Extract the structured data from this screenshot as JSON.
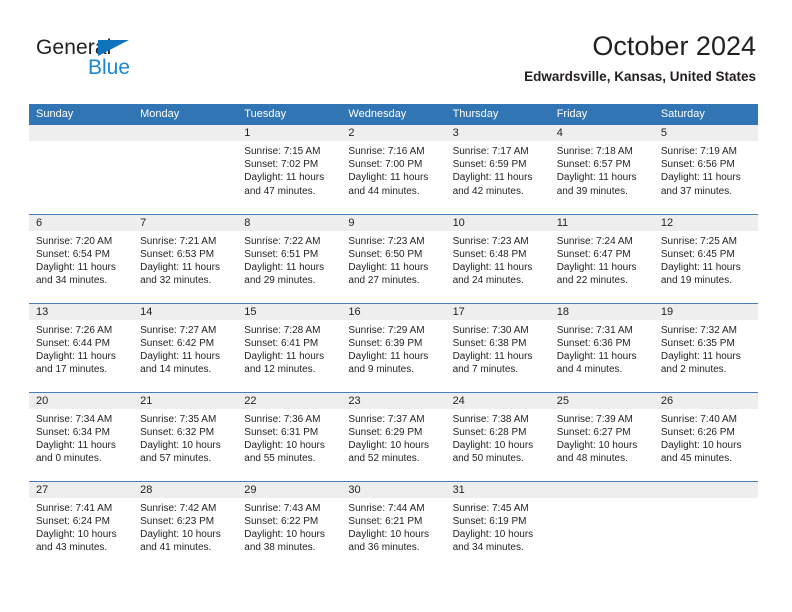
{
  "brand": {
    "name_part1": "General",
    "name_part2": "Blue",
    "accent_color": "#1b87d4",
    "triangle_color": "#0f72bd"
  },
  "header": {
    "title": "October 2024",
    "location": "Edwardsville, Kansas, United States"
  },
  "theme": {
    "header_blue": "#3275b5",
    "row_divider": "#4a7ebb",
    "daynum_band": "#eeeeee",
    "text": "#231f20"
  },
  "weekday_headers": [
    "Sunday",
    "Monday",
    "Tuesday",
    "Wednesday",
    "Thursday",
    "Friday",
    "Saturday"
  ],
  "labels": {
    "sunrise_prefix": "Sunrise: ",
    "sunset_prefix": "Sunset: ",
    "daylight_prefix": "Daylight: "
  },
  "weeks": [
    [
      {
        "day": "",
        "sunrise": "",
        "sunset": "",
        "daylight_line1": "",
        "daylight_line2": ""
      },
      {
        "day": "",
        "sunrise": "",
        "sunset": "",
        "daylight_line1": "",
        "daylight_line2": ""
      },
      {
        "day": "1",
        "sunrise": "Sunrise: 7:15 AM",
        "sunset": "Sunset: 7:02 PM",
        "daylight_line1": "Daylight: 11 hours",
        "daylight_line2": "and 47 minutes."
      },
      {
        "day": "2",
        "sunrise": "Sunrise: 7:16 AM",
        "sunset": "Sunset: 7:00 PM",
        "daylight_line1": "Daylight: 11 hours",
        "daylight_line2": "and 44 minutes."
      },
      {
        "day": "3",
        "sunrise": "Sunrise: 7:17 AM",
        "sunset": "Sunset: 6:59 PM",
        "daylight_line1": "Daylight: 11 hours",
        "daylight_line2": "and 42 minutes."
      },
      {
        "day": "4",
        "sunrise": "Sunrise: 7:18 AM",
        "sunset": "Sunset: 6:57 PM",
        "daylight_line1": "Daylight: 11 hours",
        "daylight_line2": "and 39 minutes."
      },
      {
        "day": "5",
        "sunrise": "Sunrise: 7:19 AM",
        "sunset": "Sunset: 6:56 PM",
        "daylight_line1": "Daylight: 11 hours",
        "daylight_line2": "and 37 minutes."
      }
    ],
    [
      {
        "day": "6",
        "sunrise": "Sunrise: 7:20 AM",
        "sunset": "Sunset: 6:54 PM",
        "daylight_line1": "Daylight: 11 hours",
        "daylight_line2": "and 34 minutes."
      },
      {
        "day": "7",
        "sunrise": "Sunrise: 7:21 AM",
        "sunset": "Sunset: 6:53 PM",
        "daylight_line1": "Daylight: 11 hours",
        "daylight_line2": "and 32 minutes."
      },
      {
        "day": "8",
        "sunrise": "Sunrise: 7:22 AM",
        "sunset": "Sunset: 6:51 PM",
        "daylight_line1": "Daylight: 11 hours",
        "daylight_line2": "and 29 minutes."
      },
      {
        "day": "9",
        "sunrise": "Sunrise: 7:23 AM",
        "sunset": "Sunset: 6:50 PM",
        "daylight_line1": "Daylight: 11 hours",
        "daylight_line2": "and 27 minutes."
      },
      {
        "day": "10",
        "sunrise": "Sunrise: 7:23 AM",
        "sunset": "Sunset: 6:48 PM",
        "daylight_line1": "Daylight: 11 hours",
        "daylight_line2": "and 24 minutes."
      },
      {
        "day": "11",
        "sunrise": "Sunrise: 7:24 AM",
        "sunset": "Sunset: 6:47 PM",
        "daylight_line1": "Daylight: 11 hours",
        "daylight_line2": "and 22 minutes."
      },
      {
        "day": "12",
        "sunrise": "Sunrise: 7:25 AM",
        "sunset": "Sunset: 6:45 PM",
        "daylight_line1": "Daylight: 11 hours",
        "daylight_line2": "and 19 minutes."
      }
    ],
    [
      {
        "day": "13",
        "sunrise": "Sunrise: 7:26 AM",
        "sunset": "Sunset: 6:44 PM",
        "daylight_line1": "Daylight: 11 hours",
        "daylight_line2": "and 17 minutes."
      },
      {
        "day": "14",
        "sunrise": "Sunrise: 7:27 AM",
        "sunset": "Sunset: 6:42 PM",
        "daylight_line1": "Daylight: 11 hours",
        "daylight_line2": "and 14 minutes."
      },
      {
        "day": "15",
        "sunrise": "Sunrise: 7:28 AM",
        "sunset": "Sunset: 6:41 PM",
        "daylight_line1": "Daylight: 11 hours",
        "daylight_line2": "and 12 minutes."
      },
      {
        "day": "16",
        "sunrise": "Sunrise: 7:29 AM",
        "sunset": "Sunset: 6:39 PM",
        "daylight_line1": "Daylight: 11 hours",
        "daylight_line2": "and 9 minutes."
      },
      {
        "day": "17",
        "sunrise": "Sunrise: 7:30 AM",
        "sunset": "Sunset: 6:38 PM",
        "daylight_line1": "Daylight: 11 hours",
        "daylight_line2": "and 7 minutes."
      },
      {
        "day": "18",
        "sunrise": "Sunrise: 7:31 AM",
        "sunset": "Sunset: 6:36 PM",
        "daylight_line1": "Daylight: 11 hours",
        "daylight_line2": "and 4 minutes."
      },
      {
        "day": "19",
        "sunrise": "Sunrise: 7:32 AM",
        "sunset": "Sunset: 6:35 PM",
        "daylight_line1": "Daylight: 11 hours",
        "daylight_line2": "and 2 minutes."
      }
    ],
    [
      {
        "day": "20",
        "sunrise": "Sunrise: 7:34 AM",
        "sunset": "Sunset: 6:34 PM",
        "daylight_line1": "Daylight: 11 hours",
        "daylight_line2": "and 0 minutes."
      },
      {
        "day": "21",
        "sunrise": "Sunrise: 7:35 AM",
        "sunset": "Sunset: 6:32 PM",
        "daylight_line1": "Daylight: 10 hours",
        "daylight_line2": "and 57 minutes."
      },
      {
        "day": "22",
        "sunrise": "Sunrise: 7:36 AM",
        "sunset": "Sunset: 6:31 PM",
        "daylight_line1": "Daylight: 10 hours",
        "daylight_line2": "and 55 minutes."
      },
      {
        "day": "23",
        "sunrise": "Sunrise: 7:37 AM",
        "sunset": "Sunset: 6:29 PM",
        "daylight_line1": "Daylight: 10 hours",
        "daylight_line2": "and 52 minutes."
      },
      {
        "day": "24",
        "sunrise": "Sunrise: 7:38 AM",
        "sunset": "Sunset: 6:28 PM",
        "daylight_line1": "Daylight: 10 hours",
        "daylight_line2": "and 50 minutes."
      },
      {
        "day": "25",
        "sunrise": "Sunrise: 7:39 AM",
        "sunset": "Sunset: 6:27 PM",
        "daylight_line1": "Daylight: 10 hours",
        "daylight_line2": "and 48 minutes."
      },
      {
        "day": "26",
        "sunrise": "Sunrise: 7:40 AM",
        "sunset": "Sunset: 6:26 PM",
        "daylight_line1": "Daylight: 10 hours",
        "daylight_line2": "and 45 minutes."
      }
    ],
    [
      {
        "day": "27",
        "sunrise": "Sunrise: 7:41 AM",
        "sunset": "Sunset: 6:24 PM",
        "daylight_line1": "Daylight: 10 hours",
        "daylight_line2": "and 43 minutes."
      },
      {
        "day": "28",
        "sunrise": "Sunrise: 7:42 AM",
        "sunset": "Sunset: 6:23 PM",
        "daylight_line1": "Daylight: 10 hours",
        "daylight_line2": "and 41 minutes."
      },
      {
        "day": "29",
        "sunrise": "Sunrise: 7:43 AM",
        "sunset": "Sunset: 6:22 PM",
        "daylight_line1": "Daylight: 10 hours",
        "daylight_line2": "and 38 minutes."
      },
      {
        "day": "30",
        "sunrise": "Sunrise: 7:44 AM",
        "sunset": "Sunset: 6:21 PM",
        "daylight_line1": "Daylight: 10 hours",
        "daylight_line2": "and 36 minutes."
      },
      {
        "day": "31",
        "sunrise": "Sunrise: 7:45 AM",
        "sunset": "Sunset: 6:19 PM",
        "daylight_line1": "Daylight: 10 hours",
        "daylight_line2": "and 34 minutes."
      },
      {
        "day": "",
        "sunrise": "",
        "sunset": "",
        "daylight_line1": "",
        "daylight_line2": ""
      },
      {
        "day": "",
        "sunrise": "",
        "sunset": "",
        "daylight_line1": "",
        "daylight_line2": ""
      }
    ]
  ]
}
